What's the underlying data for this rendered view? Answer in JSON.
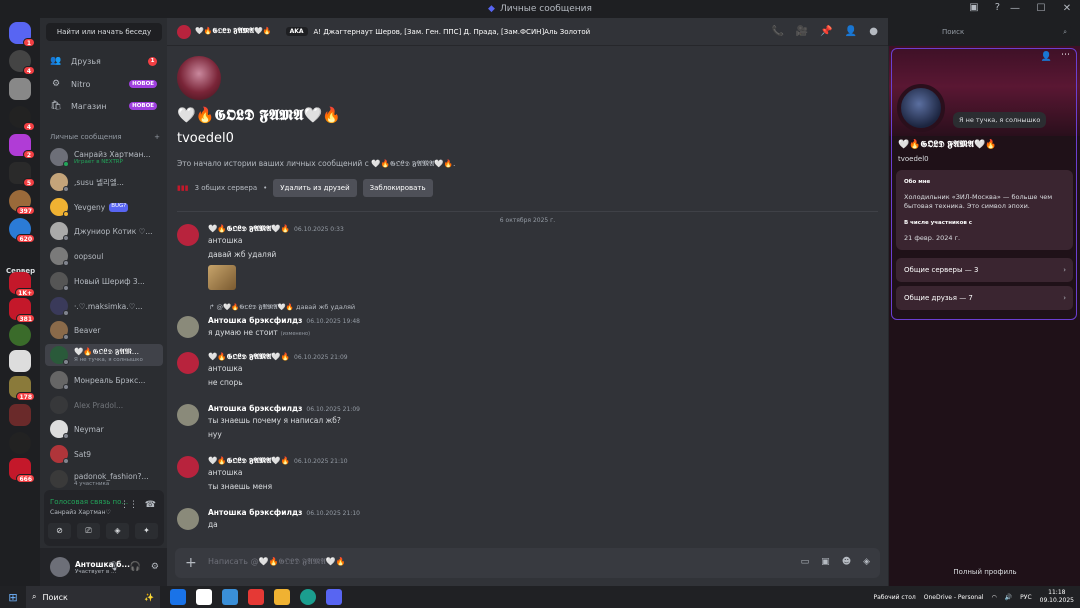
{
  "titlebar": {
    "title": "Личные сообщения",
    "controls": [
      "—",
      "☐",
      "✕"
    ]
  },
  "rail": {
    "label": "Сервер",
    "badges": [
      "1",
      "4",
      "4",
      "2",
      "5",
      "397",
      "620",
      "1K+",
      "381",
      "178",
      "666"
    ]
  },
  "sidebar": {
    "search_placeholder": "Найти или начать беседу",
    "nav": [
      {
        "label": "Друзья",
        "badge": "1"
      },
      {
        "label": "Nitro",
        "badge": "НОВОЕ"
      },
      {
        "label": "Магазин",
        "badge": "НОВОЕ"
      }
    ],
    "dm_header": "Личные сообщения",
    "dm_add": "+",
    "dms": [
      {
        "name": "Санрайз Хартман...",
        "sub": "Играет в NEXTRP"
      },
      {
        "name": ",susu 넬리엘...",
        "sub": ""
      },
      {
        "name": "Yevgeny",
        "sub": "",
        "tag": "BUG?"
      },
      {
        "name": "Джуниор Котик ♡...",
        "sub": ""
      },
      {
        "name": "oopsoul",
        "sub": ""
      },
      {
        "name": "Новый Шериф 3...",
        "sub": ""
      },
      {
        "name": "·.♡.maksimka.♡...",
        "sub": ""
      },
      {
        "name": "Beaver",
        "sub": ""
      },
      {
        "name": "🤍🔥𝕲𝕺𝕷𝕯 𝕱𝕬𝕸...",
        "sub": "Я не тучка, я солнышко"
      },
      {
        "name": "Монреаль Брэкс...",
        "sub": ""
      },
      {
        "name": "Alex Pradol...",
        "sub": ""
      },
      {
        "name": "Neymar",
        "sub": ""
      },
      {
        "name": "Sat9",
        "sub": ""
      },
      {
        "name": "padonok_fashion?...",
        "sub": "4 участника"
      }
    ],
    "voice": {
      "title": "Голосовая связь по...",
      "sub": "Санрайз Хартман♡"
    },
    "user": {
      "name": "Антошка б...",
      "status": "Участвует в ..."
    }
  },
  "chat_header": {
    "name": "🤍🔥𝕲𝕺𝕷𝕯 𝕱𝕬𝕸𝕬🤍🔥",
    "tag": "AKA",
    "status": "A! Джагтернаут Шеров, [Зам. Ген. ППС] Д. Прада, [Зам.ФСИН]Аль Золотой",
    "search_placeholder": "Поиск"
  },
  "intro": {
    "name": "🤍🔥𝕲𝕺𝕷𝕯 𝕱𝕬𝕸𝕬🤍🔥",
    "username": "tvoedel0",
    "description": "Это начало истории ваших личных сообщений с 🤍🔥𝕲𝕺𝕷𝕯 𝕱𝕬𝕸𝕬🤍🔥.",
    "mutual_servers": "3 общих сервера",
    "remove_friend": "Удалить из друзей",
    "block": "Заблокировать"
  },
  "date_divider": "6 октября 2025 г.",
  "messages": [
    {
      "author": "🤍🔥𝕲𝕺𝕷𝕯 𝕱𝕬𝕸𝕬🤍🔥",
      "time": "06.10.2025 0:33",
      "lines": [
        "антошка",
        "давай жб удаляй"
      ]
    },
    {
      "reply_to": "@🤍🔥𝕲𝕺𝕷𝕯 𝕱𝕬𝕸𝕬🤍🔥 давай жб удаляй",
      "author": "Антошка брэксфилдз",
      "time": "06.10.2025 19:48",
      "lines": [
        "я думаю не стоит"
      ],
      "edited": "(изменено)"
    },
    {
      "author": "🤍🔥𝕲𝕺𝕷𝕯 𝕱𝕬𝕸𝕬🤍🔥",
      "time": "06.10.2025 21:09",
      "lines": [
        "антошка",
        "не спорь"
      ]
    },
    {
      "author": "Антошка брэксфилдз",
      "time": "06.10.2025 21:09",
      "lines": [
        "ты знаешь почему я написал жб?",
        "нуу"
      ]
    },
    {
      "author": "🤍🔥𝕲𝕺𝕷𝕯 𝕱𝕬𝕸𝕬🤍🔥",
      "time": "06.10.2025 21:10",
      "lines": [
        "антошка",
        "ты знаешь меня"
      ]
    },
    {
      "author": "Антошка брэксфилдз",
      "time": "06.10.2025 21:10",
      "lines": [
        "да"
      ]
    }
  ],
  "input": {
    "placeholder": "Написать @🤍🔥𝕲𝕺𝕷𝕯 𝕱𝕬𝕸𝕬🤍🔥"
  },
  "profile": {
    "custom_status": "Я не тучка, я солнышко",
    "name": "🤍🔥𝕲𝕺𝕷𝕯 𝕱𝕬𝕸𝕬🤍🔥",
    "username": "tvoedel0",
    "about_header": "Обо мне",
    "about_text": "Холодильник «ЗИЛ-Москва» — больше чем бытовая техника. Это символ эпохи.",
    "member_since_header": "В числе участников с",
    "member_since": "21 февр. 2024 г.",
    "mutual_servers": "Общие серверы — 3",
    "mutual_friends": "Общие друзья — 7",
    "full_profile": "Полный профиль"
  },
  "taskbar": {
    "search": "Поиск",
    "desktop": "Рабочий стол",
    "onedrive": "OneDrive - Personal",
    "lang": "РУС",
    "time": "11:18",
    "date": "09.10.2025"
  },
  "colors": {
    "accent": "#5865f2",
    "online": "#23a55a",
    "badge": "#f23f43",
    "nitro": "#a03fe0"
  }
}
